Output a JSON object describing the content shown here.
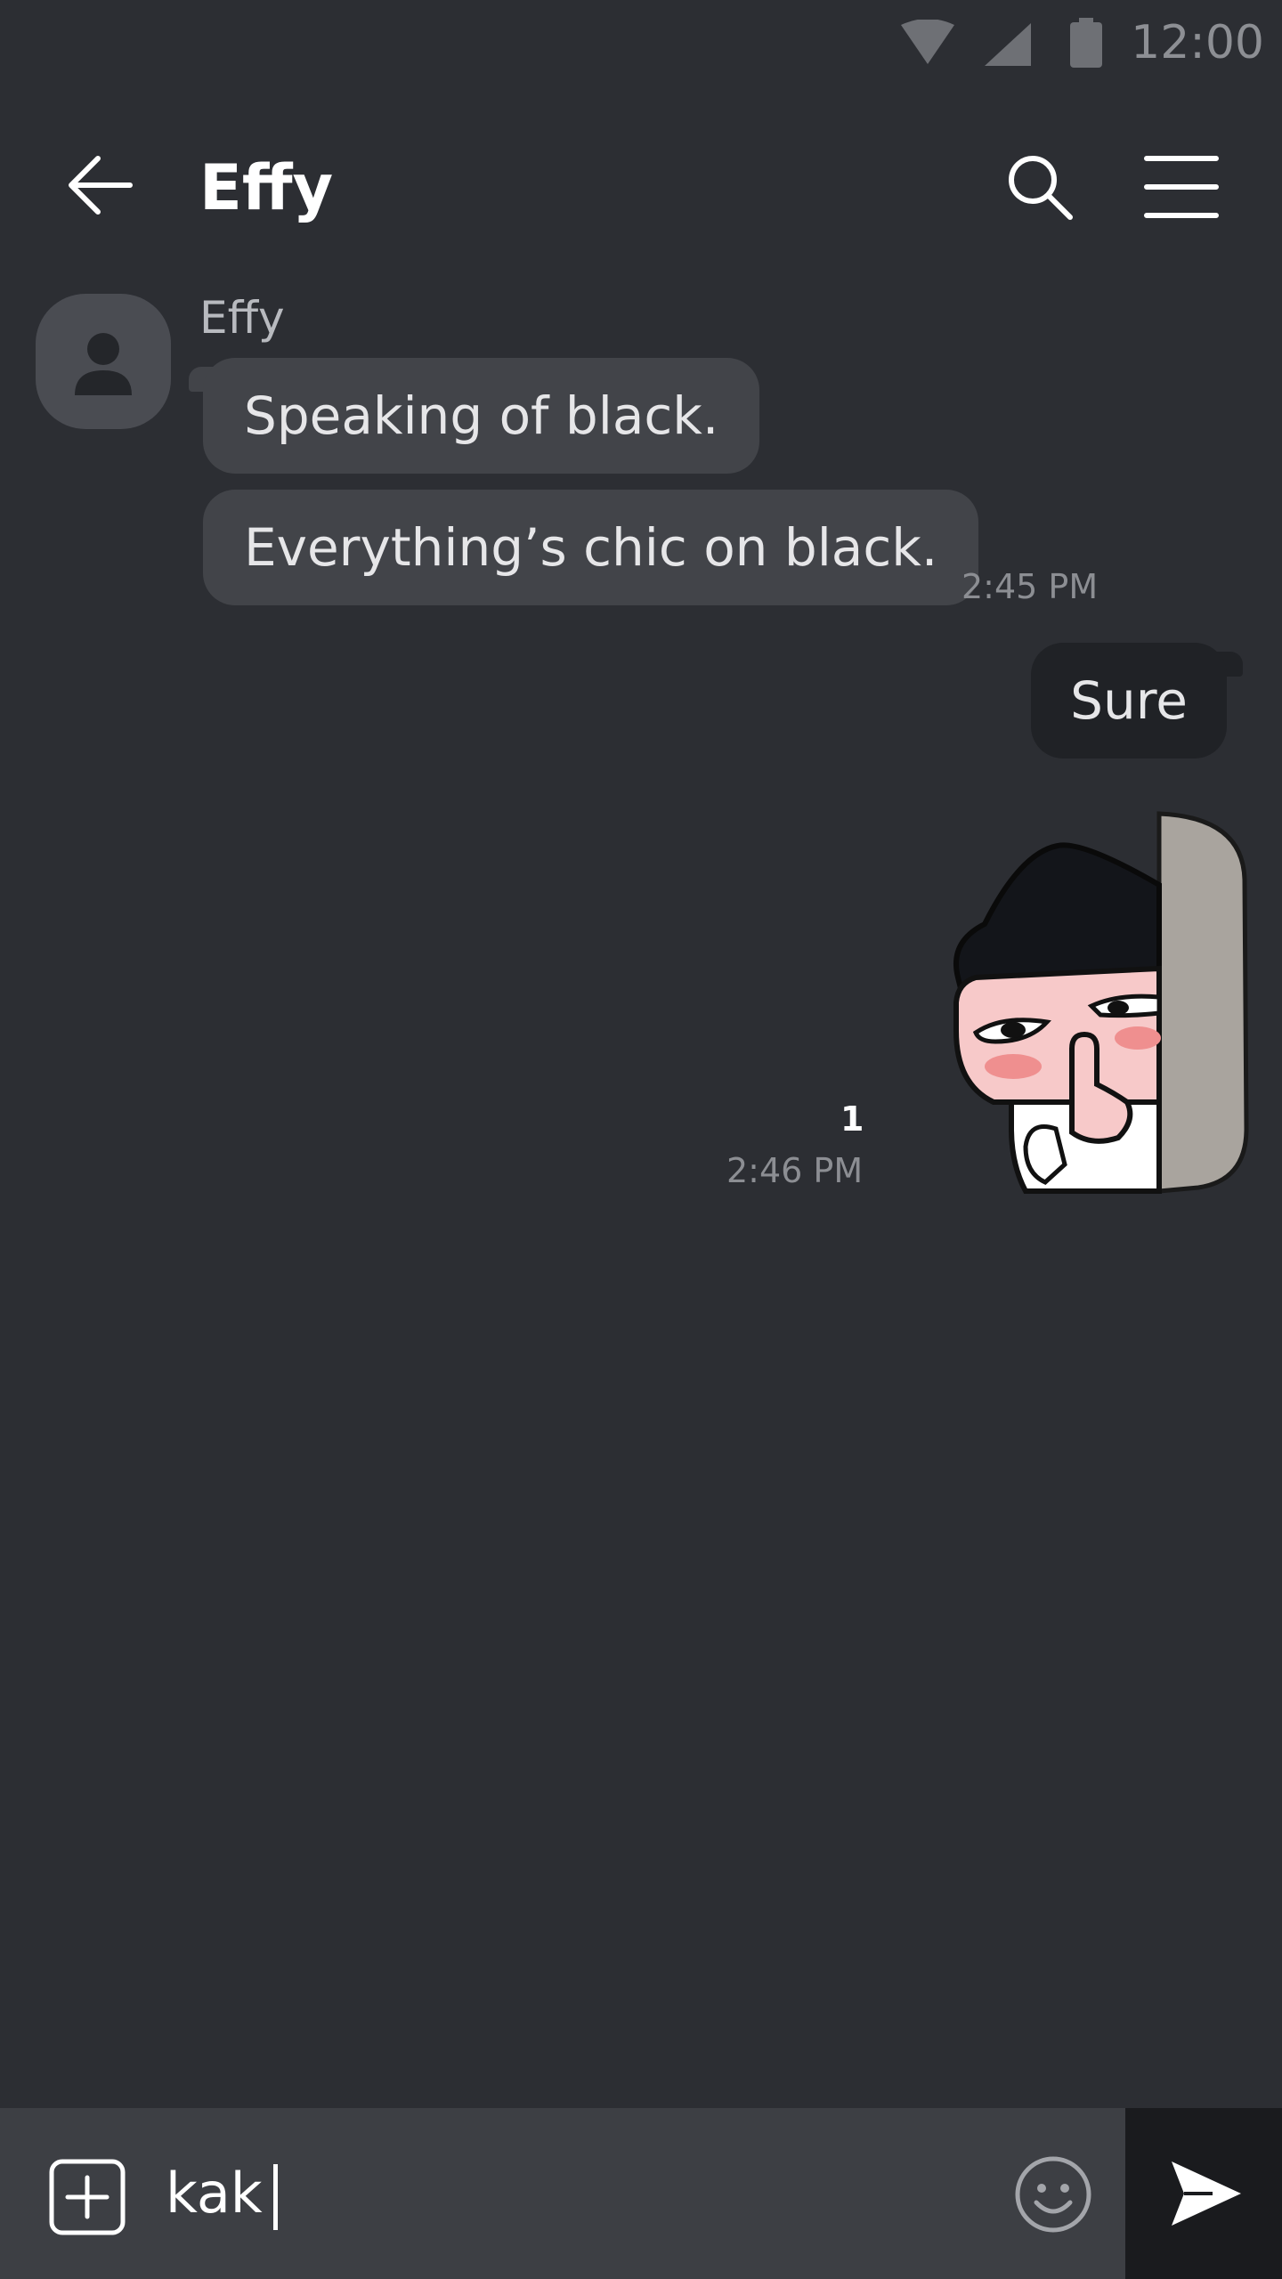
{
  "status_bar": {
    "time": "12:00",
    "icons": [
      "wifi-icon",
      "cell-signal-icon",
      "battery-icon"
    ]
  },
  "header": {
    "title": "Effy",
    "icons": [
      "back-arrow-icon",
      "search-icon",
      "menu-icon"
    ]
  },
  "conversation": {
    "incoming": {
      "sender": "Effy",
      "messages": [
        "Speaking of black.",
        "Everything’s chic on black."
      ],
      "time": "2:45 PM"
    },
    "outgoing": {
      "messages": [
        "Sure"
      ],
      "sticker": "shushing-character-sticker",
      "unread_count": "1",
      "time": "2:46 PM"
    }
  },
  "composer": {
    "value": "kak",
    "icons": [
      "add-icon",
      "emoji-icon",
      "send-icon"
    ]
  },
  "colors": {
    "background": "#2c2e33",
    "incoming_bubble": "#424449",
    "outgoing_bubble": "#202226",
    "composer": "#3d3f44",
    "send_button": "#1a1b1e"
  }
}
